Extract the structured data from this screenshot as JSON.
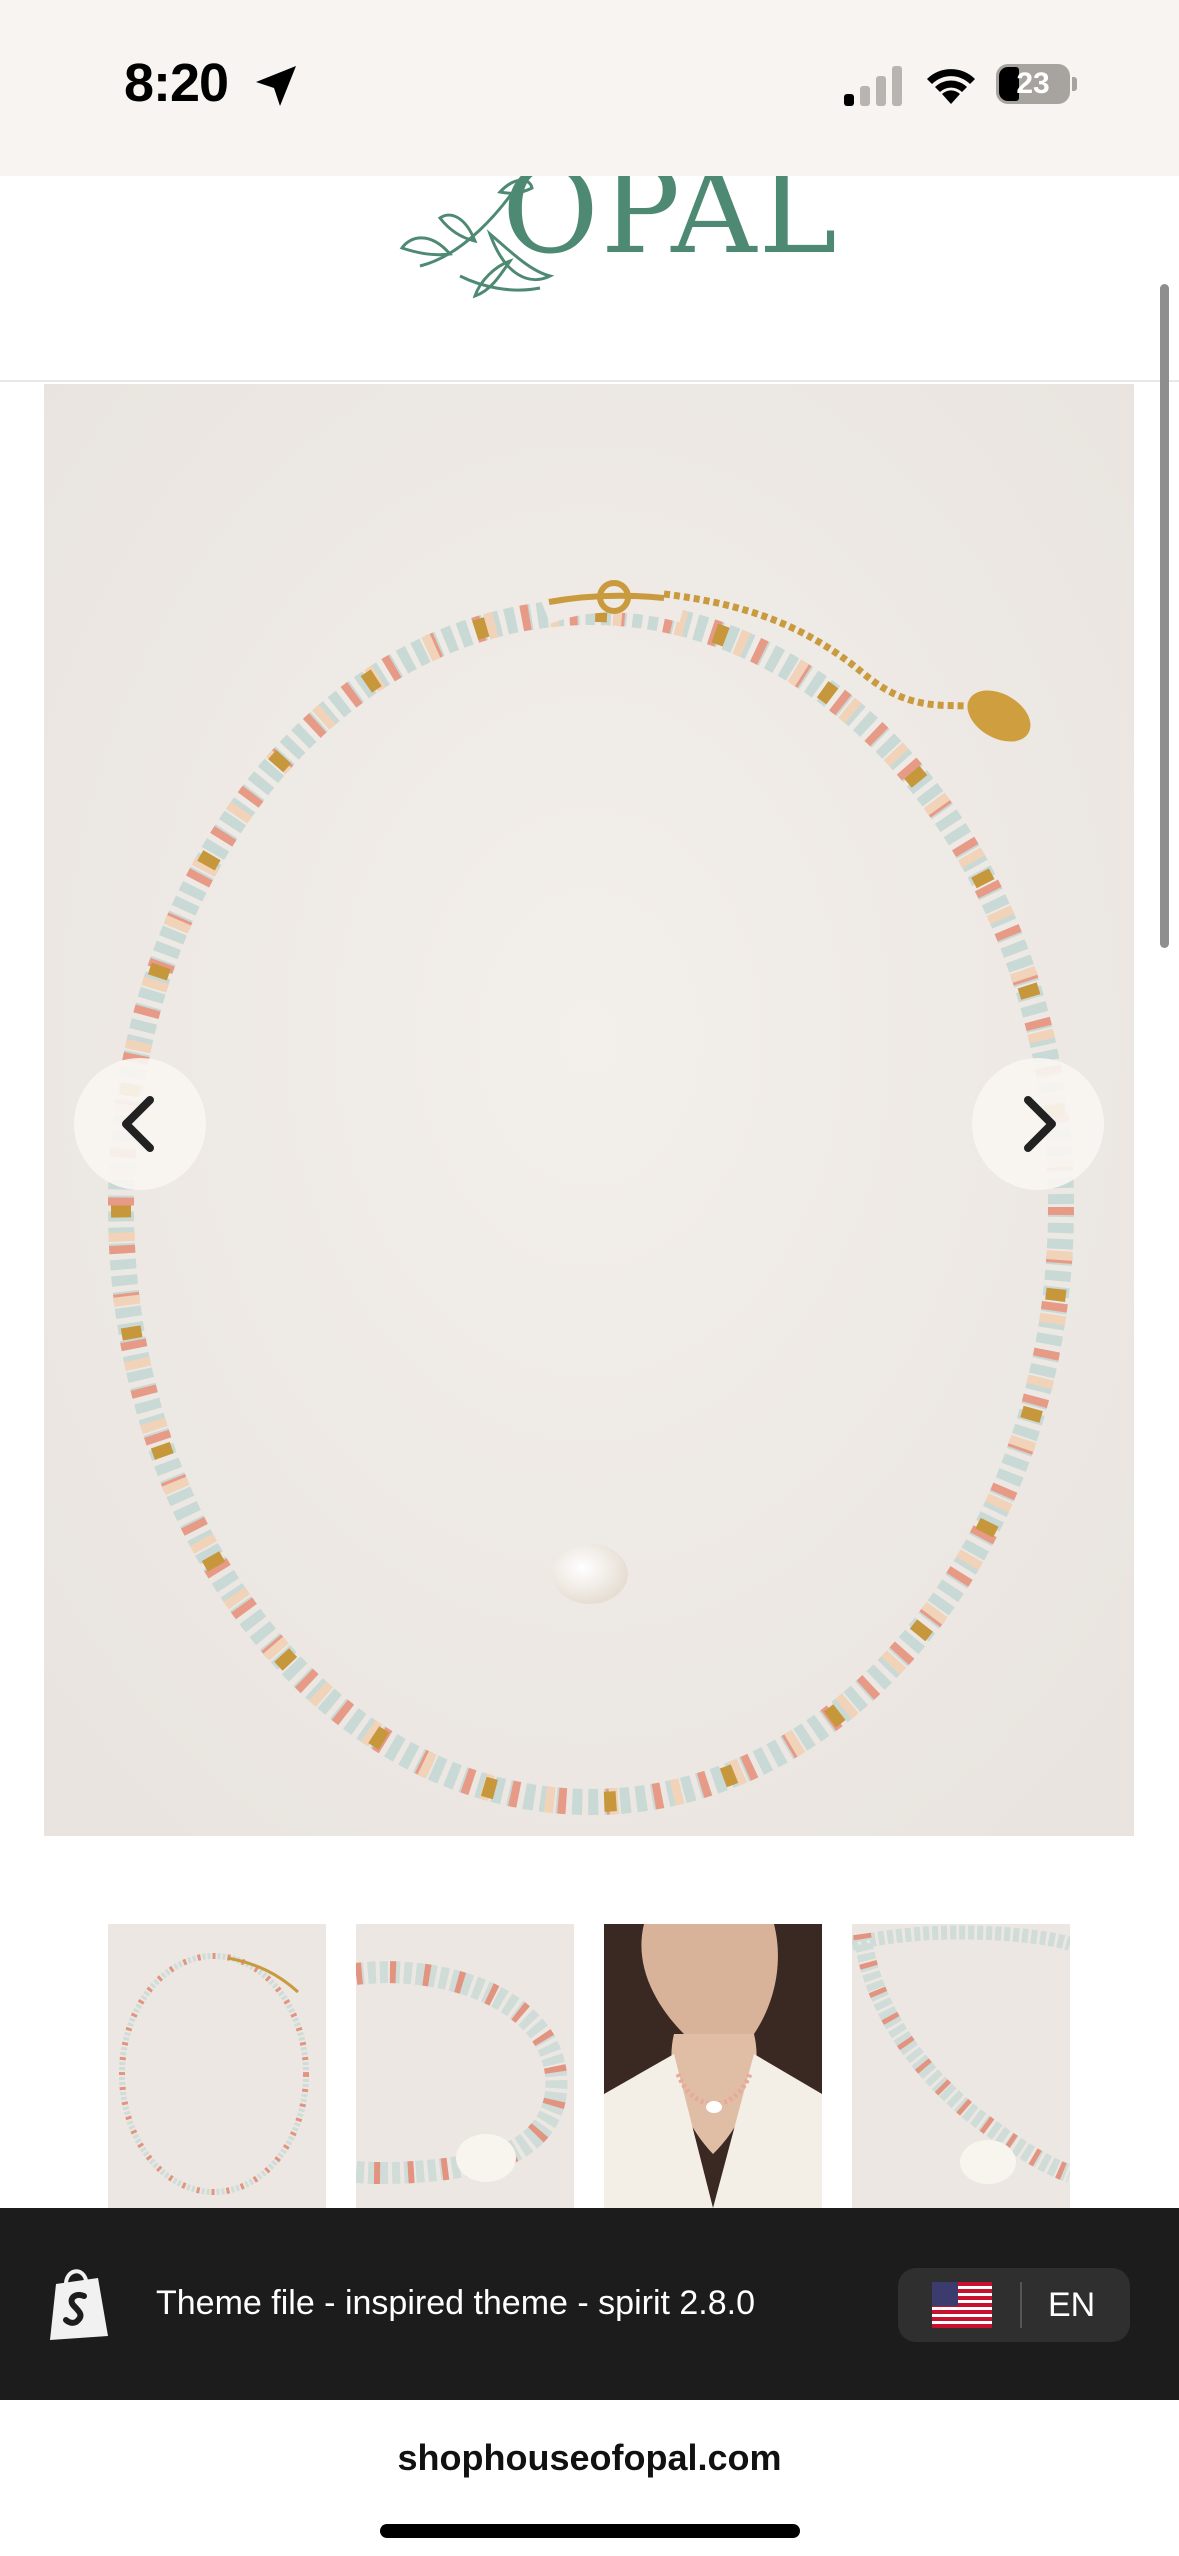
{
  "status_bar": {
    "time": "8:20",
    "battery": "23",
    "icons": [
      "location-arrow-icon",
      "cellular-signal-icon",
      "wifi-icon",
      "battery-icon"
    ]
  },
  "header": {
    "logo_text": "OPAL",
    "logo_color": "#4e8a73"
  },
  "gallery": {
    "main_image_alt": "necklace-photo",
    "prev_icon": "chevron-left-icon",
    "next_icon": "chevron-right-icon",
    "thumbnails": [
      "thumbnail-necklace-full",
      "thumbnail-necklace-detail",
      "thumbnail-necklace-worn",
      "thumbnail-necklace-closeup"
    ]
  },
  "shopify_bar": {
    "icon": "shopify-bag-icon",
    "text": "Theme file - inspired theme - spirit 2.8.0",
    "language": "EN",
    "flag_icon": "us-flag-icon",
    "background": "#1c1c1c"
  },
  "browser": {
    "url": "shophouseofopal.com"
  }
}
